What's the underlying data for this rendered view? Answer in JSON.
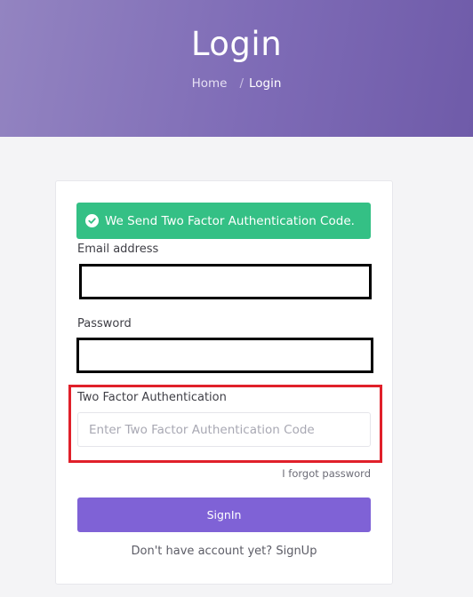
{
  "header": {
    "title": "Login",
    "breadcrumb": {
      "home": "Home",
      "separator": "/",
      "current": "Login"
    }
  },
  "alert": {
    "icon": "check-circle-icon",
    "message": "We Send Two Factor Authentication Code."
  },
  "form": {
    "email_label": "Email address",
    "email_value": "",
    "password_label": "Password",
    "password_value": "",
    "twofa_label": "Two Factor Authentication",
    "twofa_placeholder": "Enter Two Factor Authentication Code",
    "twofa_value": "",
    "forgot_password": "I forgot password",
    "submit_label": "SignIn"
  },
  "footer": {
    "prompt": "Don't have account yet?",
    "signup_link": "SignUp"
  },
  "colors": {
    "header_gradient_start": "#9384c1",
    "header_gradient_end": "#6f5ba9",
    "alert_success": "#34c085",
    "primary_button": "#7f62d6",
    "highlight_border": "#e0202a",
    "redaction_border": "#000000"
  }
}
